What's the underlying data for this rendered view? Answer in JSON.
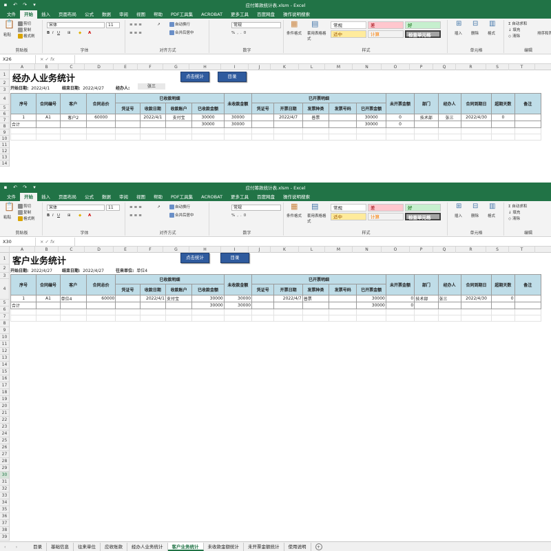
{
  "window1": {
    "title": "应付筹款统计表.xlsm - Excel",
    "menu": [
      "文件",
      "开始",
      "插入",
      "页面布局",
      "公式",
      "数据",
      "审阅",
      "视图",
      "帮助",
      "PDF工具集",
      "ACROBAT",
      "更多工具",
      "百度网盘",
      "操作说明搜索"
    ],
    "ribbon": {
      "paste": "粘贴",
      "cut": "剪切",
      "copy": "复制",
      "format_painter": "格式刷",
      "clipboard": "剪贴板",
      "font_name": "宋体",
      "font_size": "11",
      "font_group": "字体",
      "wrap": "自动换行",
      "merge": "合并后居中",
      "align_group": "对齐方式",
      "num_format": "常规",
      "number_group": "数字",
      "cond_format": "条件格式",
      "table_format": "套用表格格式",
      "style_normal": "常规",
      "style_bad": "差",
      "style_good": "好",
      "style_neutral": "适中",
      "style_calc": "计算",
      "style_check": "检查单元格",
      "styles_group": "样式",
      "insert": "插入",
      "delete": "删除",
      "format": "格式",
      "cells_group": "单元格",
      "autosum": "自动求和",
      "fill": "填充",
      "clear": "清除",
      "sort": "排序和筛选",
      "editing_group": "编辑"
    },
    "name_box": "X26",
    "columns": [
      "A",
      "B",
      "C",
      "D",
      "E",
      "F",
      "G",
      "H",
      "I",
      "J",
      "K",
      "L",
      "M",
      "N",
      "O",
      "P",
      "Q",
      "R",
      "S",
      "T"
    ],
    "rows": [
      "1",
      "2",
      "3",
      "4",
      "5",
      "6",
      "7",
      "8",
      "9",
      "10",
      "11",
      "12",
      "13",
      "14"
    ],
    "sheet_title": "经办人业务统计",
    "start_label": "开始日期:",
    "start_value": "2022/4/1",
    "end_label": "结束日期:",
    "end_value": "2022/4/27",
    "filter_label": "经办人:",
    "filter_value": "张三",
    "btn_stats": "点击统计",
    "btn_menu": "目录",
    "headers": {
      "seq": "序号",
      "contract": "合同编号",
      "customer": "客户",
      "total": "合同总价",
      "received_group": "已收款明细",
      "voucher": "凭证号",
      "recv_date": "收款日期",
      "recv_acct": "收款账户",
      "recv_amt": "已收款金额",
      "unrecv": "未收款金额",
      "invoiced_group": "已开票明细",
      "inv_voucher": "凭证号",
      "inv_date": "开票日期",
      "inv_type": "发票种类",
      "inv_no": "发票号码",
      "inv_amt": "已开票金额",
      "uninv": "未开票金额",
      "dept": "部门",
      "handler": "经办人",
      "due": "合同到期日",
      "overdue": "超期天数",
      "note": "备注"
    },
    "row": {
      "seq": "1",
      "contract": "A1",
      "customer": "客户2",
      "total": "60000",
      "recv_date": "2022/4/1",
      "recv_acct": "支付宝",
      "recv_amt": "30000",
      "unrecv": "30000",
      "inv_date": "2022/4/7",
      "inv_type": "普票",
      "inv_amt": "30000",
      "uninv": "0",
      "dept": "技术部",
      "handler": "张三",
      "due": "2022/4/30",
      "overdue": "0"
    },
    "total": {
      "label": "合计",
      "recv_amt": "30000",
      "unrecv": "30000",
      "inv_amt": "30000",
      "uninv": "0"
    }
  },
  "window2": {
    "title": "应付筹款统计表.xlsm - Excel",
    "name_box": "X30",
    "sheet_title": "客户业务统计",
    "start_label": "开始日期:",
    "start_value": "2022/4/27",
    "end_label": "结束日期:",
    "end_value": "2022/4/27",
    "filter_label": "往来单位:",
    "filter_value": "单位4",
    "btn_stats": "点击统计",
    "btn_menu": "目录",
    "rows": [
      "1",
      "2",
      "3",
      "4",
      "5",
      "6",
      "7",
      "8",
      "9",
      "10",
      "11",
      "12",
      "13",
      "14",
      "15",
      "16",
      "17",
      "18",
      "19",
      "20",
      "21",
      "22",
      "23",
      "24",
      "25",
      "26",
      "27",
      "28",
      "29",
      "30",
      "31",
      "32",
      "33",
      "34",
      "35",
      "36",
      "37",
      "38",
      "39"
    ],
    "row": {
      "seq": "1",
      "contract": "A1",
      "customer": "单位4",
      "total": "60000",
      "recv_date": "2022/4/1",
      "recv_acct": "支付宝",
      "recv_amt": "30000",
      "unrecv": "30000",
      "inv_date": "2022/4/7",
      "inv_type": "普票",
      "inv_amt": "30000",
      "uninv": "0",
      "dept": "技术部",
      "handler": "张三",
      "due": "2022/4/30",
      "overdue": "0"
    },
    "total": {
      "label": "合计",
      "recv_amt": "30000",
      "unrecv": "30000",
      "inv_amt": "30000",
      "uninv": "0"
    },
    "sheet_tabs": [
      "目录",
      "基础信息",
      "往来单位",
      "应收账款",
      "经办人业务统计",
      "客户业务统计",
      "未收款金额统计",
      "未开票金额统计",
      "使用说明"
    ],
    "active_tab": "客户业务统计"
  },
  "colors": {
    "excel_green": "#217346",
    "header_fill": "#bfdde8",
    "button_blue": "#2f5b9e"
  }
}
